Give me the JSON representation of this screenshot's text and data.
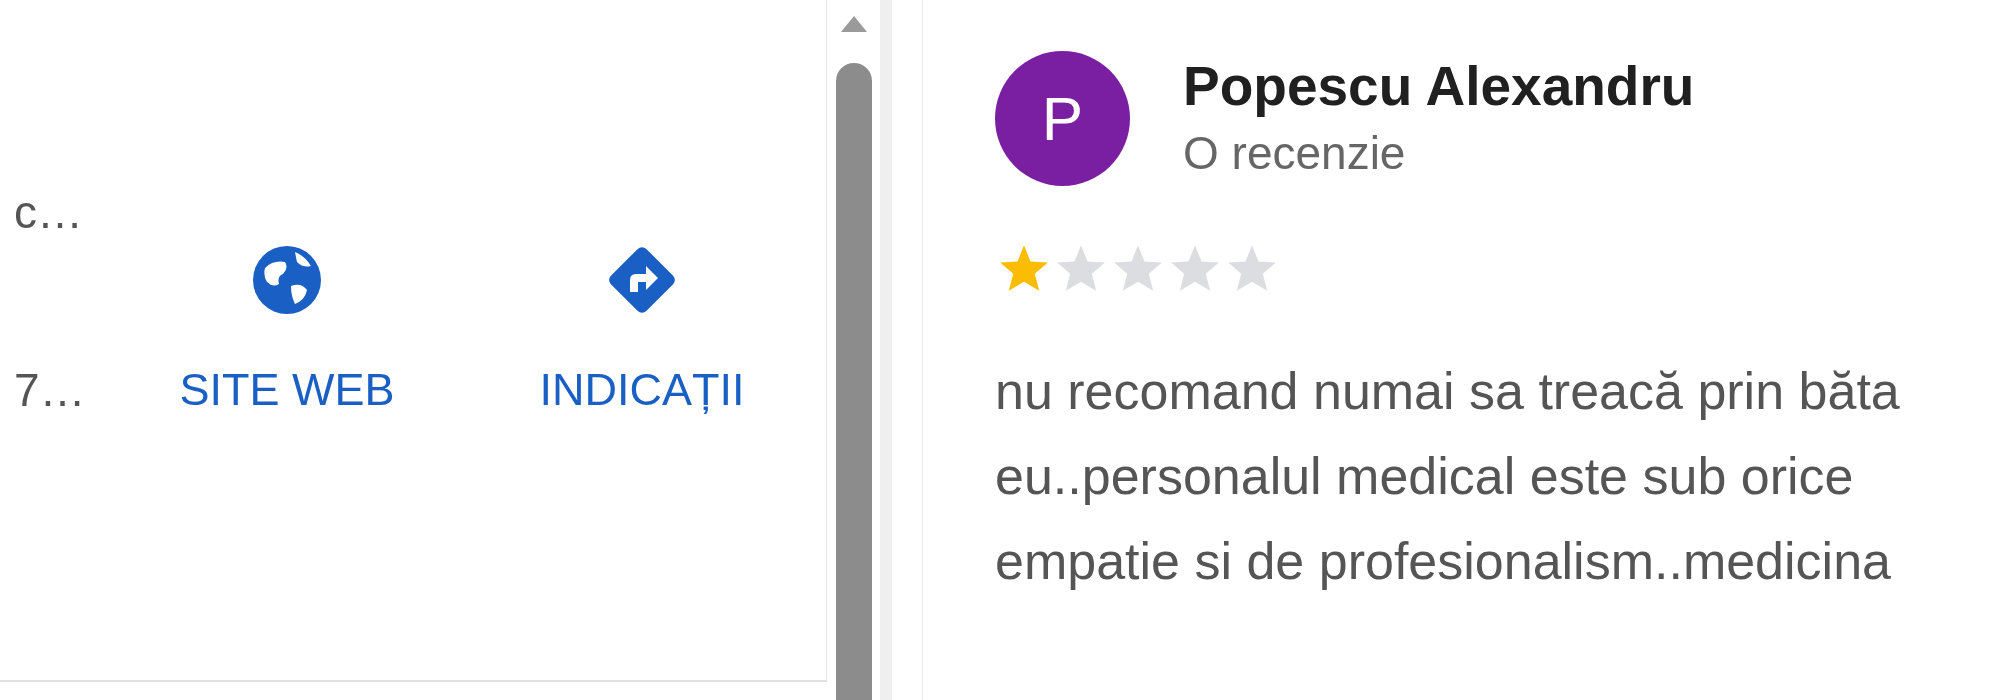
{
  "place_panel": {
    "info_lines": [
      "c…",
      "7…"
    ],
    "actions": [
      {
        "kind": "website",
        "label": "SITE WEB"
      },
      {
        "kind": "directions",
        "label": "INDICAȚII"
      }
    ]
  },
  "review": {
    "avatar_letter": "P",
    "author": "Popescu Alexandru",
    "author_meta": "O recenzie",
    "stars": 1,
    "text": "nu recomand numai sa treacă prin băta\neu..personalul medical este sub orice\nempatie si de profesionalism..medicina"
  }
}
